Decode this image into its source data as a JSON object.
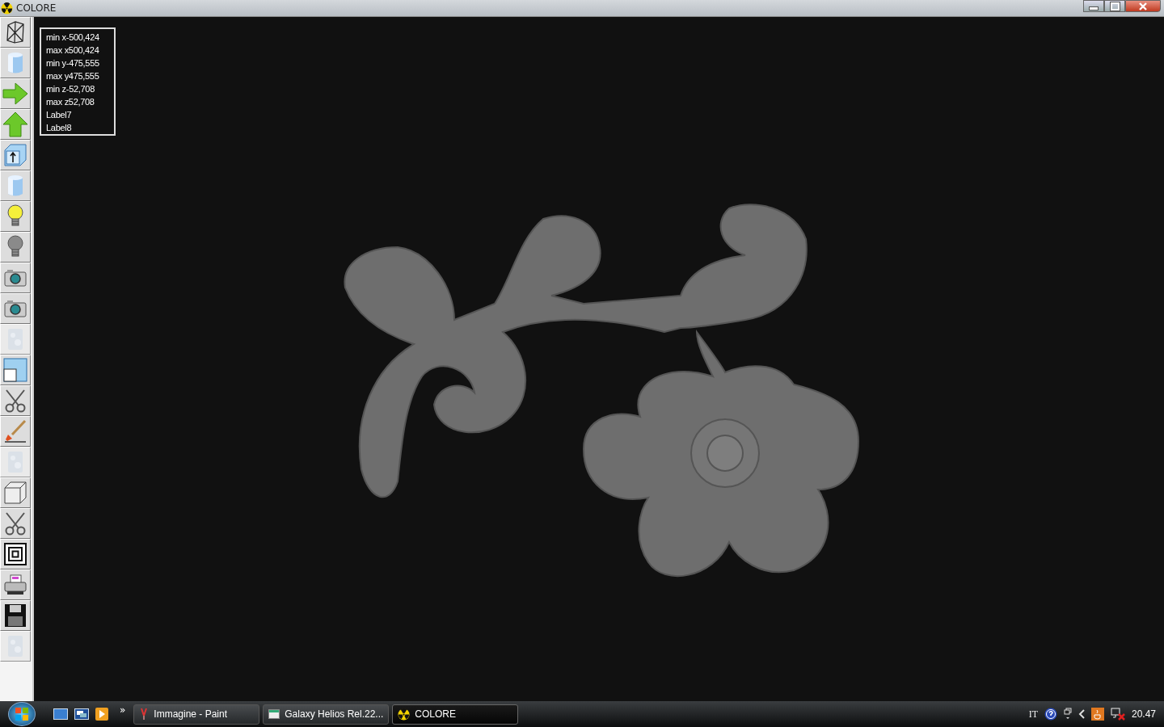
{
  "window": {
    "title": "COLORE"
  },
  "tools": [
    {
      "kind": "wireframe",
      "disabled": false
    },
    {
      "kind": "cylinder",
      "disabled": false
    },
    {
      "kind": "arrow-right",
      "disabled": false
    },
    {
      "kind": "arrow-up",
      "disabled": false
    },
    {
      "kind": "box-arrow",
      "disabled": false
    },
    {
      "kind": "cylinder",
      "disabled": false
    },
    {
      "kind": "bulb-on",
      "disabled": false
    },
    {
      "kind": "bulb-off",
      "disabled": false
    },
    {
      "kind": "camera",
      "disabled": false
    },
    {
      "kind": "camera",
      "disabled": false
    },
    {
      "kind": "texture",
      "disabled": true
    },
    {
      "kind": "window-split",
      "disabled": false
    },
    {
      "kind": "scissors",
      "disabled": false
    },
    {
      "kind": "brush",
      "disabled": false
    },
    {
      "kind": "texture",
      "disabled": true
    },
    {
      "kind": "cube",
      "disabled": false
    },
    {
      "kind": "scissors",
      "disabled": false
    },
    {
      "kind": "concentric",
      "disabled": false
    },
    {
      "kind": "printer",
      "disabled": false
    },
    {
      "kind": "floppy",
      "disabled": false
    },
    {
      "kind": "texture",
      "disabled": true
    }
  ],
  "info_labels": [
    "min x-500,424",
    "max x500,424",
    "min y-475,555",
    "max y475,555",
    "min z-52,708",
    "max z52,708",
    "Label7",
    "Label8"
  ],
  "taskbar": {
    "tasks": [
      {
        "label": "Immagine - Paint",
        "kind": "paint",
        "selected": false
      },
      {
        "label": "Galaxy Helios  Rel.22...",
        "kind": "helios",
        "selected": false
      },
      {
        "label": "COLORE",
        "kind": "colore",
        "selected": true
      }
    ],
    "language": "IT",
    "clock": "20.47",
    "overflow": "»"
  }
}
